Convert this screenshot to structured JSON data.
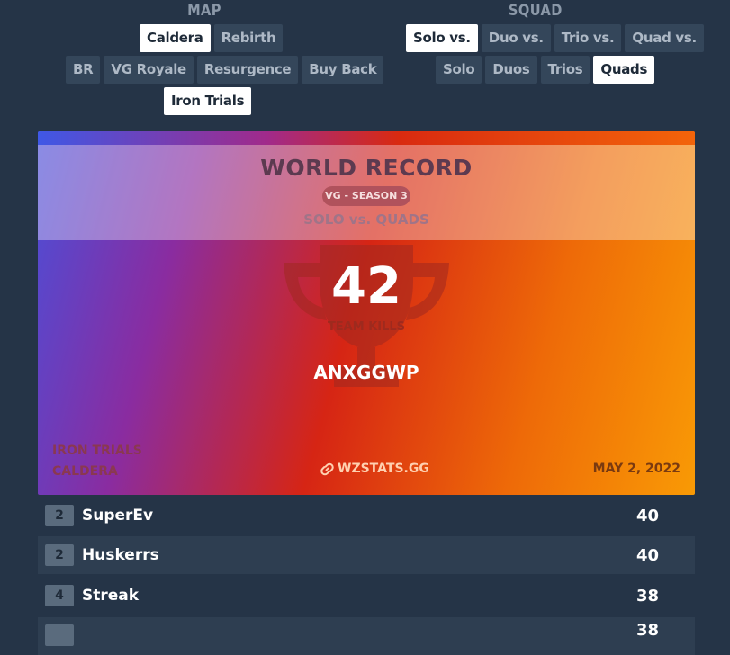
{
  "map": {
    "title": "MAP",
    "row1": [
      {
        "label": "Caldera",
        "active": true
      },
      {
        "label": "Rebirth",
        "active": false
      }
    ],
    "row2": [
      {
        "label": "BR",
        "active": false
      },
      {
        "label": "VG Royale",
        "active": false
      },
      {
        "label": "Resurgence",
        "active": false
      },
      {
        "label": "Buy Back",
        "active": false
      }
    ],
    "row3": [
      {
        "label": "Iron Trials",
        "active": true
      }
    ]
  },
  "squad": {
    "title": "SQUAD",
    "row1": [
      {
        "label": "Solo vs.",
        "active": true
      },
      {
        "label": "Duo vs.",
        "active": false
      },
      {
        "label": "Trio vs.",
        "active": false
      },
      {
        "label": "Quad vs.",
        "active": false
      }
    ],
    "row2": [
      {
        "label": "Solo",
        "active": false
      },
      {
        "label": "Duos",
        "active": false
      },
      {
        "label": "Trios",
        "active": false
      },
      {
        "label": "Quads",
        "active": true
      }
    ]
  },
  "record": {
    "title": "WORLD RECORD",
    "season": "VG - SEASON 3",
    "mode": "SOLO vs. QUADS",
    "kills": "42",
    "kills_label": "TEAM KILLS",
    "player": "ANXGGWP",
    "map_line1": "IRON TRIALS",
    "map_line2": "CALDERA",
    "site": "WZSTATS.GG",
    "date": "MAY 2, 2022"
  },
  "leaderboard": [
    {
      "rank": "2",
      "name": "SuperEv",
      "kills": "40"
    },
    {
      "rank": "2",
      "name": "Huskerrs",
      "kills": "40"
    },
    {
      "rank": "4",
      "name": "Streak",
      "kills": "38"
    },
    {
      "rank": "",
      "name": "",
      "kills": "38"
    }
  ],
  "colors": {
    "active_button": "#ffffff",
    "button": "#34465a",
    "background": "#253447"
  },
  "icons": {
    "trophy": "trophy-icon",
    "link": "link-icon"
  }
}
